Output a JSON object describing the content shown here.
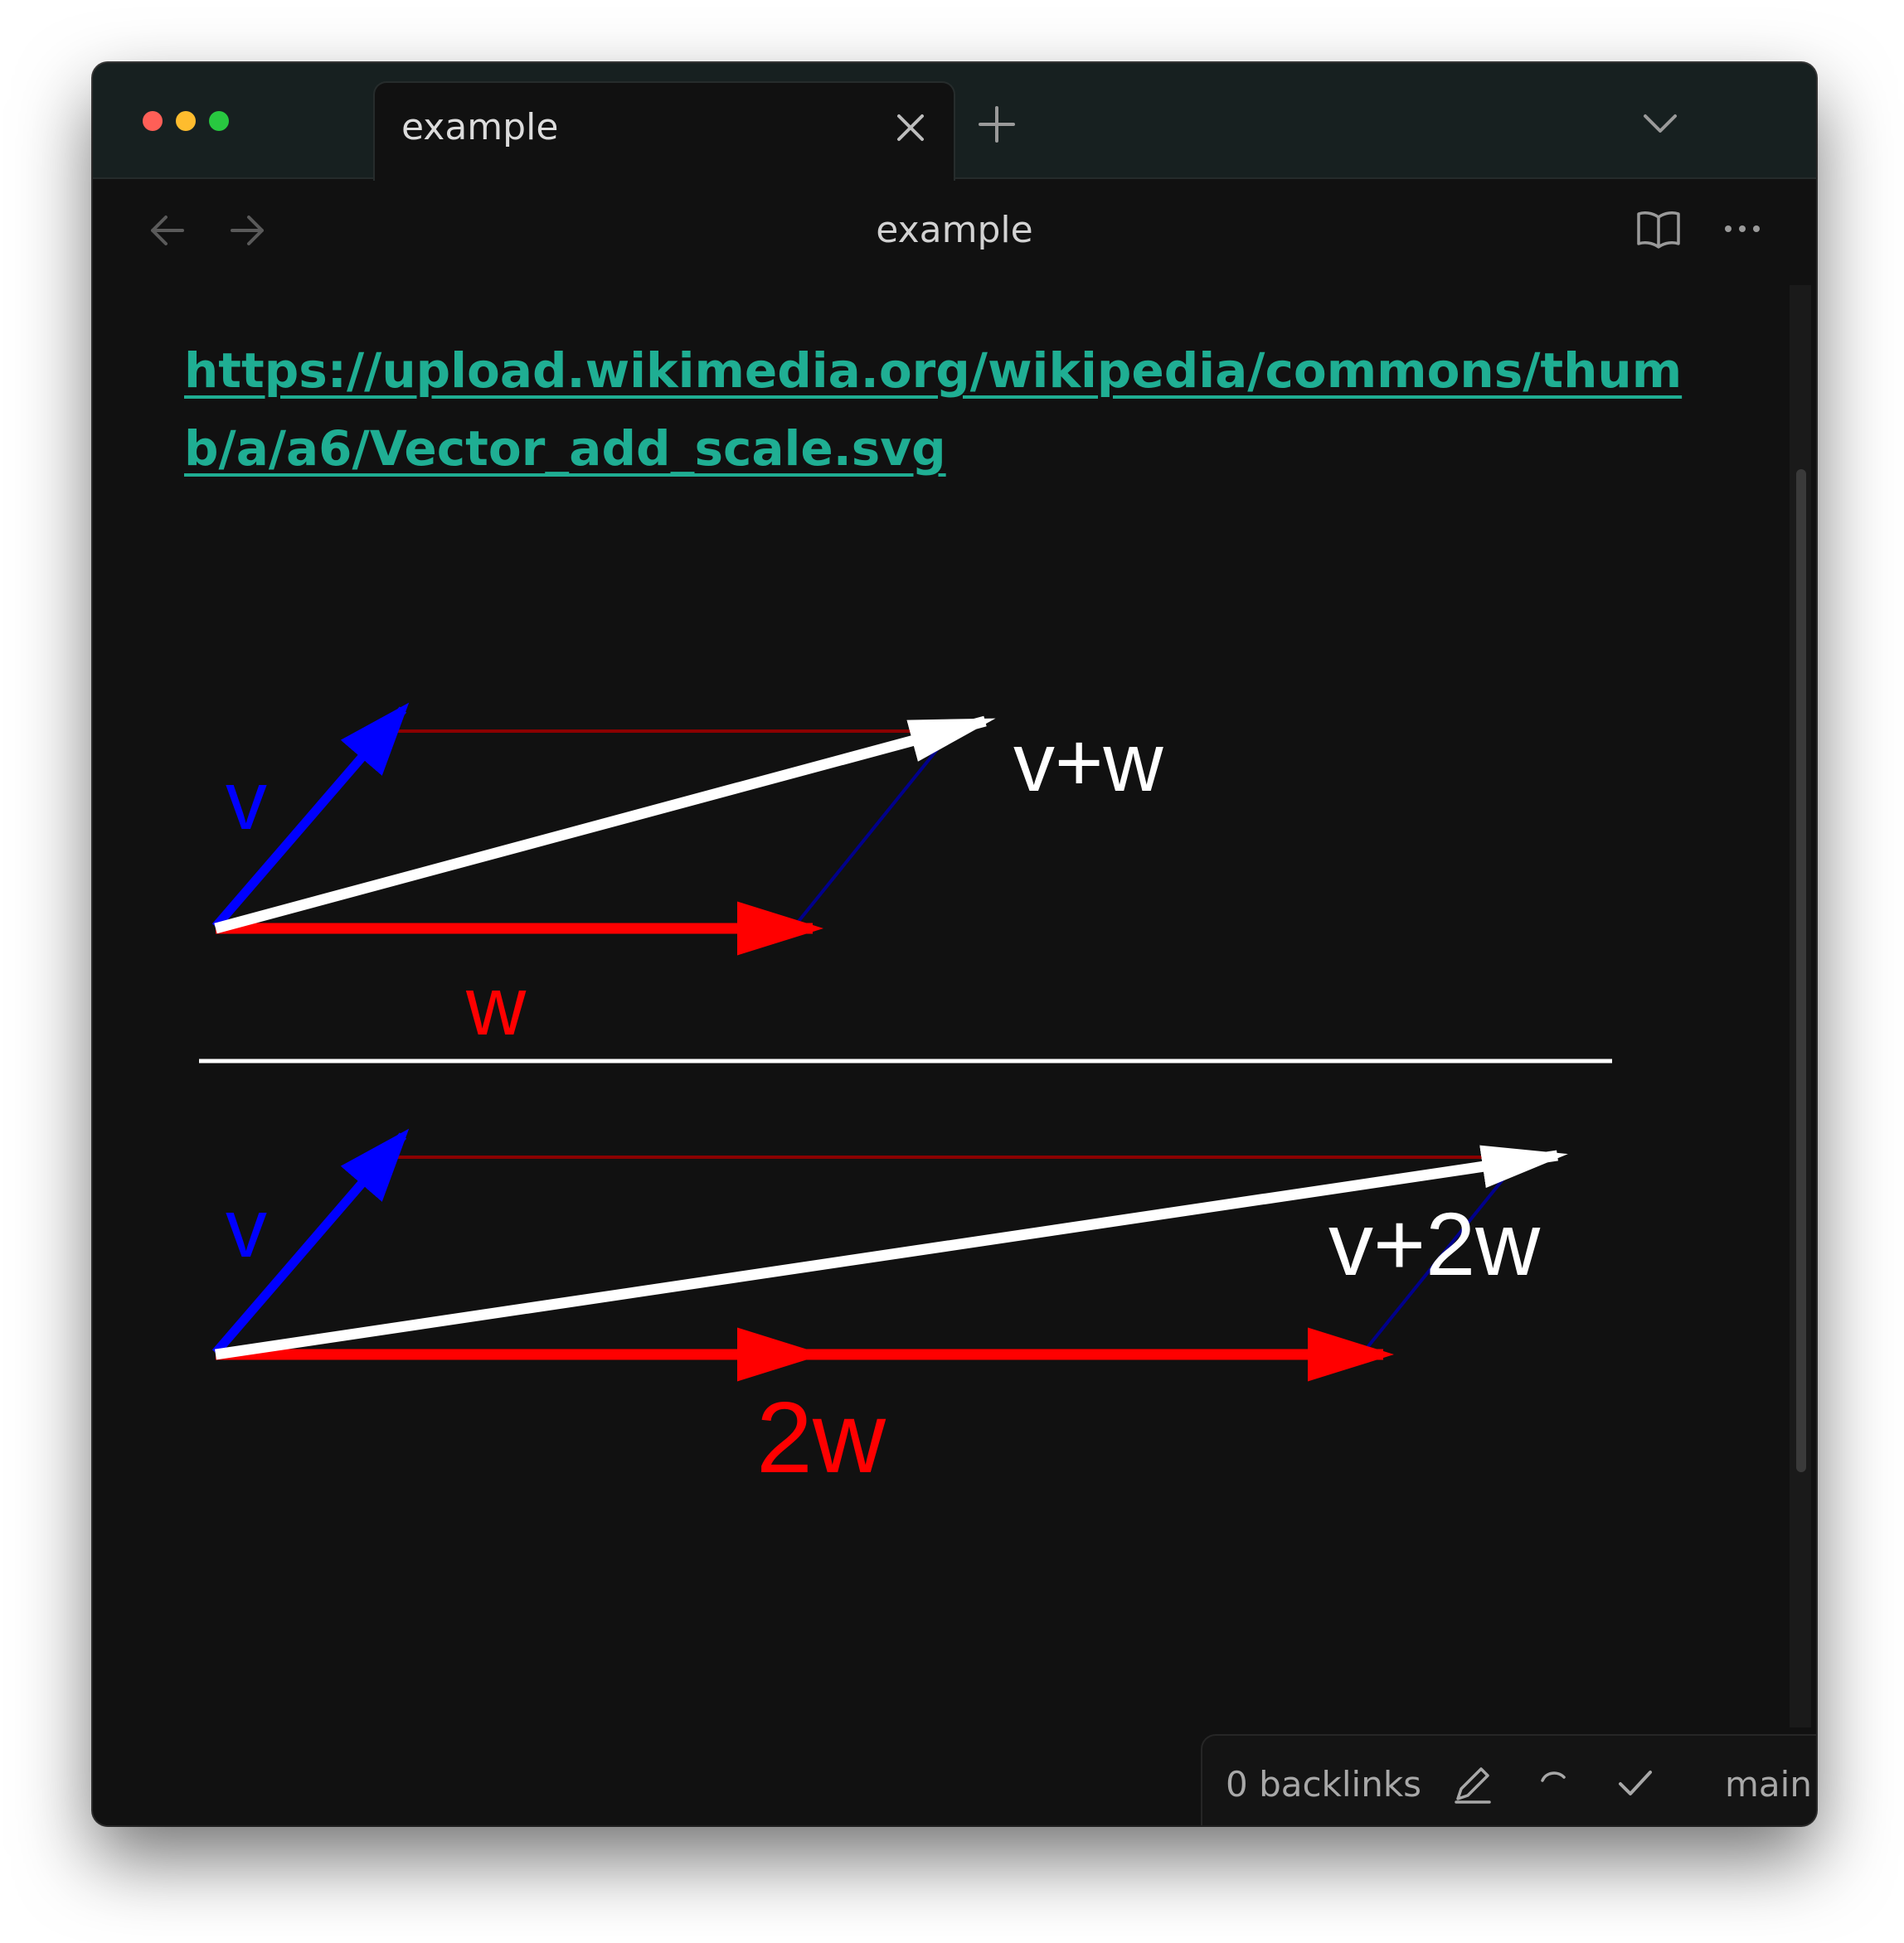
{
  "window": {
    "tab": {
      "label": "example"
    },
    "view_title": "example"
  },
  "note": {
    "link_text": "https://upload.wikimedia.org/wikipedia/commons/thumb/a/a6/Vector_add_scale.svg"
  },
  "figure": {
    "top_diagram": {
      "v_label": "v",
      "w_label": "w",
      "sum_label": "v+w"
    },
    "bottom_diagram": {
      "v_label": "v",
      "w_label": "2w",
      "sum_label": "v+2w"
    },
    "colors": {
      "v": "#0000ff",
      "w": "#ff0000",
      "sum": "#ffffff",
      "guide_red": "#8b0000",
      "guide_blue": "#00008b"
    }
  },
  "statusbar": {
    "backlinks": "0 backlinks",
    "branch": "main"
  },
  "icons": [
    "close-icon",
    "plus-icon",
    "chevron-down-icon",
    "arrow-left-icon",
    "arrow-right-icon",
    "book-open-icon",
    "more-horizontal-icon",
    "pencil-icon",
    "sync-icon",
    "check-icon"
  ]
}
